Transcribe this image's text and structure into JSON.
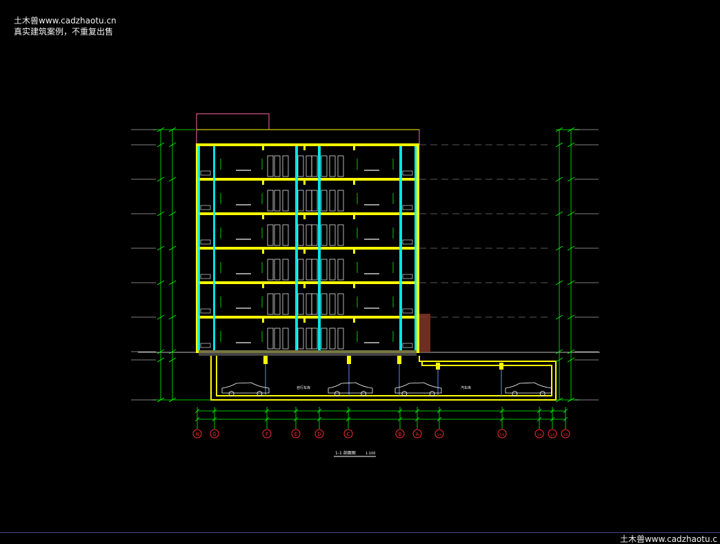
{
  "watermark_top": {
    "line1": "土木兽www.cadzhaotu.cn",
    "line2": "真实建筑案例，不重复出售"
  },
  "watermark_bottom": "土木兽www.cadzhaotu.c",
  "drawing": {
    "title": "1-1 剖面图",
    "scale": "1:100",
    "axis_labels": [
      "H",
      "G",
      "F",
      "E",
      "D",
      "C",
      "B",
      "A",
      "1/4",
      "1/4",
      "1/4",
      "1/4",
      "1/4"
    ],
    "room_labels": [
      "自行车库",
      "汽车库"
    ],
    "colors": {
      "wall": "#ffff00",
      "glass": "#00ffff",
      "line": "#00ff00",
      "bubble": "#ff3030",
      "white": "#ffffff",
      "brick": "#8b3a2a"
    }
  }
}
